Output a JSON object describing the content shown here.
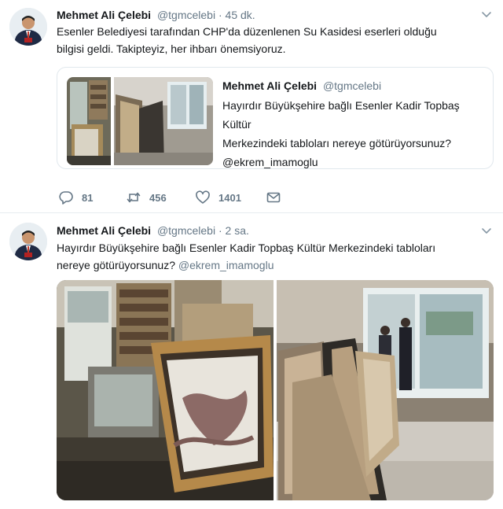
{
  "tweets": [
    {
      "author_name": "Mehmet Ali Çelebi",
      "author_handle": "@tgmcelebi",
      "separator": "·",
      "time": "45 dk.",
      "text_line1": "Esenler Belediyesi tarafından CHP'da düzenlenen Su Kasidesi eserleri olduğu",
      "text_line2": "bilgisi geldi. Takipteyiz, her ihbarı önemsiyoruz.",
      "quoted": {
        "author_name": "Mehmet Ali Çelebi",
        "author_handle": "@tgmcelebi",
        "text_line1": "Hayırdır Büyükşehire bağlı Esenler Kadir Topbaş Kültür",
        "text_line2": "Merkezindeki tabloları nereye götürüyorsunuz?",
        "text_line3": "@ekrem_imamoglu"
      },
      "actions": {
        "reply_count": "81",
        "retweet_count": "456",
        "like_count": "1401"
      },
      "icons": [
        "reply-icon",
        "retweet-icon",
        "like-icon",
        "message-icon",
        "chevron-down-icon"
      ]
    },
    {
      "author_name": "Mehmet Ali Çelebi",
      "author_handle": "@tgmcelebi",
      "separator": "·",
      "time": "2 sa.",
      "text_line1": "Hayırdır Büyükşehire bağlı Esenler Kadir Topbaş Kültür Merkezindeki tabloları",
      "text_line2_prefix": "nereye götürüyorsunuz?",
      "text_line2_mention": "@ekrem_imamoglu"
    }
  ],
  "colors": {
    "primary_text": "#14171a",
    "secondary_text": "#657786",
    "border": "#e1e8ed"
  }
}
